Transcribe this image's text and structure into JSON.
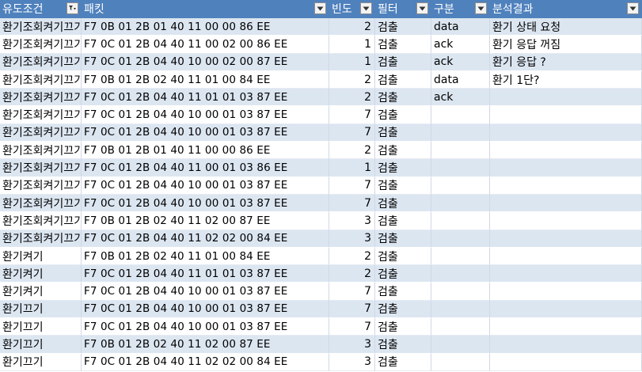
{
  "columns": [
    {
      "label": "유도조건",
      "filter_icon": "filter-applied-icon"
    },
    {
      "label": "패킷",
      "filter_icon": "dropdown-arrow-icon"
    },
    {
      "label": "빈도",
      "filter_icon": "dropdown-arrow-icon"
    },
    {
      "label": "필터",
      "filter_icon": "dropdown-arrow-icon"
    },
    {
      "label": "구분",
      "filter_icon": "dropdown-arrow-icon"
    },
    {
      "label": "분석결과",
      "filter_icon": "dropdown-arrow-icon"
    }
  ],
  "rows": [
    {
      "condition": "환기조회켜기끄기",
      "packet": "F7 0B 01 2B 01 40 11 00 00 86 EE",
      "freq": "2",
      "filter": "검출",
      "type": "data",
      "result": "환기 상태 요청"
    },
    {
      "condition": "환기조회켜기끄기",
      "packet": "F7 0C 01 2B 04 40 11 00 02 00 86 EE",
      "freq": "1",
      "filter": "검출",
      "type": "ack",
      "result": "환기 응답 꺼짐"
    },
    {
      "condition": "환기조회켜기끄기",
      "packet": "F7 0C 01 2B 04 40 10 00 02 00 87 EE",
      "freq": "1",
      "filter": "검출",
      "type": "ack",
      "result": "환기 응답 ?"
    },
    {
      "condition": "환기조회켜기끄기",
      "packet": "F7 0B 01 2B 02 40 11 01 00 84 EE",
      "freq": "2",
      "filter": "검출",
      "type": "data",
      "result": "환기 1단?"
    },
    {
      "condition": "환기조회켜기끄기",
      "packet": "F7 0C 01 2B 04 40 11 01 01 03 87 EE",
      "freq": "2",
      "filter": "검출",
      "type": "ack",
      "result": ""
    },
    {
      "condition": "환기조회켜기끄기",
      "packet": "F7 0C 01 2B 04 40 10 00 01 03 87 EE",
      "freq": "7",
      "filter": "검출",
      "type": "",
      "result": ""
    },
    {
      "condition": "환기조회켜기끄기",
      "packet": "F7 0C 01 2B 04 40 10 00 01 03 87 EE",
      "freq": "7",
      "filter": "검출",
      "type": "",
      "result": ""
    },
    {
      "condition": "환기조회켜기끄기",
      "packet": "F7 0B 01 2B 01 40 11 00 00 86 EE",
      "freq": "2",
      "filter": "검출",
      "type": "",
      "result": ""
    },
    {
      "condition": "환기조회켜기끄기",
      "packet": "F7 0C 01 2B 04 40 11 00 01 03 86 EE",
      "freq": "1",
      "filter": "검출",
      "type": "",
      "result": ""
    },
    {
      "condition": "환기조회켜기끄기",
      "packet": "F7 0C 01 2B 04 40 10 00 01 03 87 EE",
      "freq": "7",
      "filter": "검출",
      "type": "",
      "result": ""
    },
    {
      "condition": "환기조회켜기끄기",
      "packet": "F7 0C 01 2B 04 40 10 00 01 03 87 EE",
      "freq": "7",
      "filter": "검출",
      "type": "",
      "result": ""
    },
    {
      "condition": "환기조회켜기끄기",
      "packet": "F7 0B 01 2B 02 40 11 02 00 87 EE",
      "freq": "3",
      "filter": "검출",
      "type": "",
      "result": ""
    },
    {
      "condition": "환기조회켜기끄기",
      "packet": "F7 0C 01 2B 04 40 11 02 02 00 84 EE",
      "freq": "3",
      "filter": "검출",
      "type": "",
      "result": ""
    },
    {
      "condition": "환기켜기",
      "packet": "F7 0B 01 2B 02 40 11 01 00 84 EE",
      "freq": "2",
      "filter": "검출",
      "type": "",
      "result": ""
    },
    {
      "condition": "환기켜기",
      "packet": "F7 0C 01 2B 04 40 11 01 01 03 87 EE",
      "freq": "2",
      "filter": "검출",
      "type": "",
      "result": ""
    },
    {
      "condition": "환기켜기",
      "packet": "F7 0C 01 2B 04 40 10 00 01 03 87 EE",
      "freq": "7",
      "filter": "검출",
      "type": "",
      "result": ""
    },
    {
      "condition": "환기끄기",
      "packet": "F7 0C 01 2B 04 40 10 00 01 03 87 EE",
      "freq": "7",
      "filter": "검출",
      "type": "",
      "result": ""
    },
    {
      "condition": "환기끄기",
      "packet": "F7 0C 01 2B 04 40 10 00 01 03 87 EE",
      "freq": "7",
      "filter": "검출",
      "type": "",
      "result": ""
    },
    {
      "condition": "환기끄기",
      "packet": "F7 0B 01 2B 02 40 11 02 00 87 EE",
      "freq": "3",
      "filter": "검출",
      "type": "",
      "result": ""
    },
    {
      "condition": "환기끄기",
      "packet": "F7 0C 01 2B 04 40 11 02 02 00 84 EE",
      "freq": "3",
      "filter": "검출",
      "type": "",
      "result": ""
    }
  ],
  "colors": {
    "header_bg": "#4f81bd",
    "band_bg": "#dce6f1",
    "header_text": "#ffffff"
  }
}
